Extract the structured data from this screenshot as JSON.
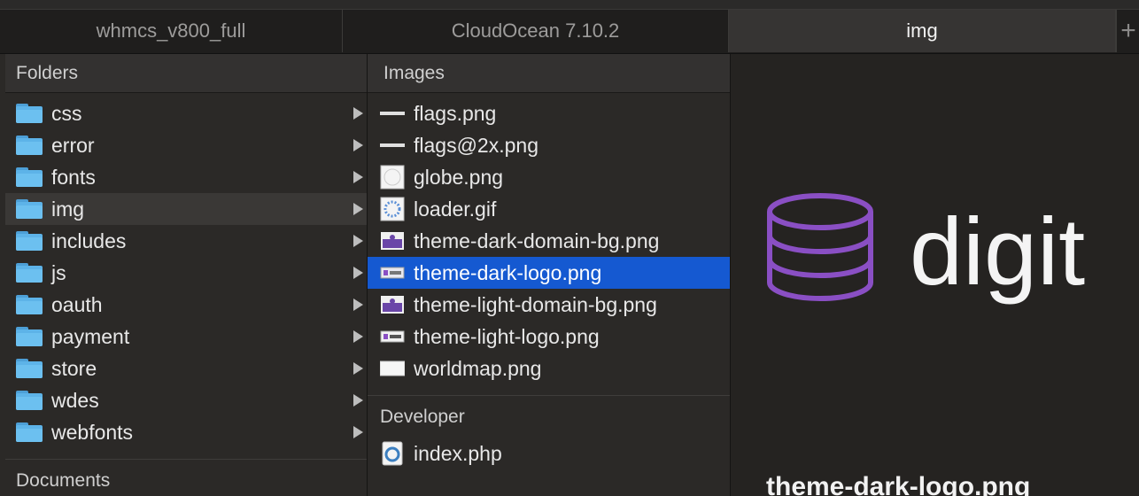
{
  "tabs": [
    {
      "label": "whmcs_v800_full",
      "active": false
    },
    {
      "label": "CloudOcean 7.10.2",
      "active": false
    },
    {
      "label": "img",
      "active": true
    }
  ],
  "tab_add": "+",
  "folders": {
    "header": "Folders",
    "items": [
      {
        "label": "css"
      },
      {
        "label": "error"
      },
      {
        "label": "fonts"
      },
      {
        "label": "img"
      },
      {
        "label": "includes"
      },
      {
        "label": "js"
      },
      {
        "label": "oauth"
      },
      {
        "label": "payment"
      },
      {
        "label": "store"
      },
      {
        "label": "wdes"
      },
      {
        "label": "webfonts"
      }
    ],
    "documents_header": "Documents"
  },
  "images": {
    "header": "Images",
    "items": [
      {
        "label": "flags.png",
        "icon": "flags-thumb-icon"
      },
      {
        "label": "flags@2x.png",
        "icon": "flags-thumb-icon"
      },
      {
        "label": "globe.png",
        "icon": "globe-thumb-icon"
      },
      {
        "label": "loader.gif",
        "icon": "loader-thumb-icon"
      },
      {
        "label": "theme-dark-domain-bg.png",
        "icon": "domain-bg-thumb-icon"
      },
      {
        "label": "theme-dark-logo.png",
        "icon": "logo-thumb-icon"
      },
      {
        "label": "theme-light-domain-bg.png",
        "icon": "domain-bg-thumb-icon"
      },
      {
        "label": "theme-light-logo.png",
        "icon": "logo-thumb-icon"
      },
      {
        "label": "worldmap.png",
        "icon": "worldmap-thumb-icon"
      }
    ],
    "developer_header": "Developer",
    "developer_items": [
      {
        "label": "index.php",
        "icon": "php-file-icon"
      }
    ]
  },
  "preview": {
    "logo_text": "digit",
    "filename": "theme-dark-logo.png"
  },
  "colors": {
    "selection": "#1559d1",
    "folder": "#5db3e8",
    "logo_purple": "#8a4fc4"
  }
}
